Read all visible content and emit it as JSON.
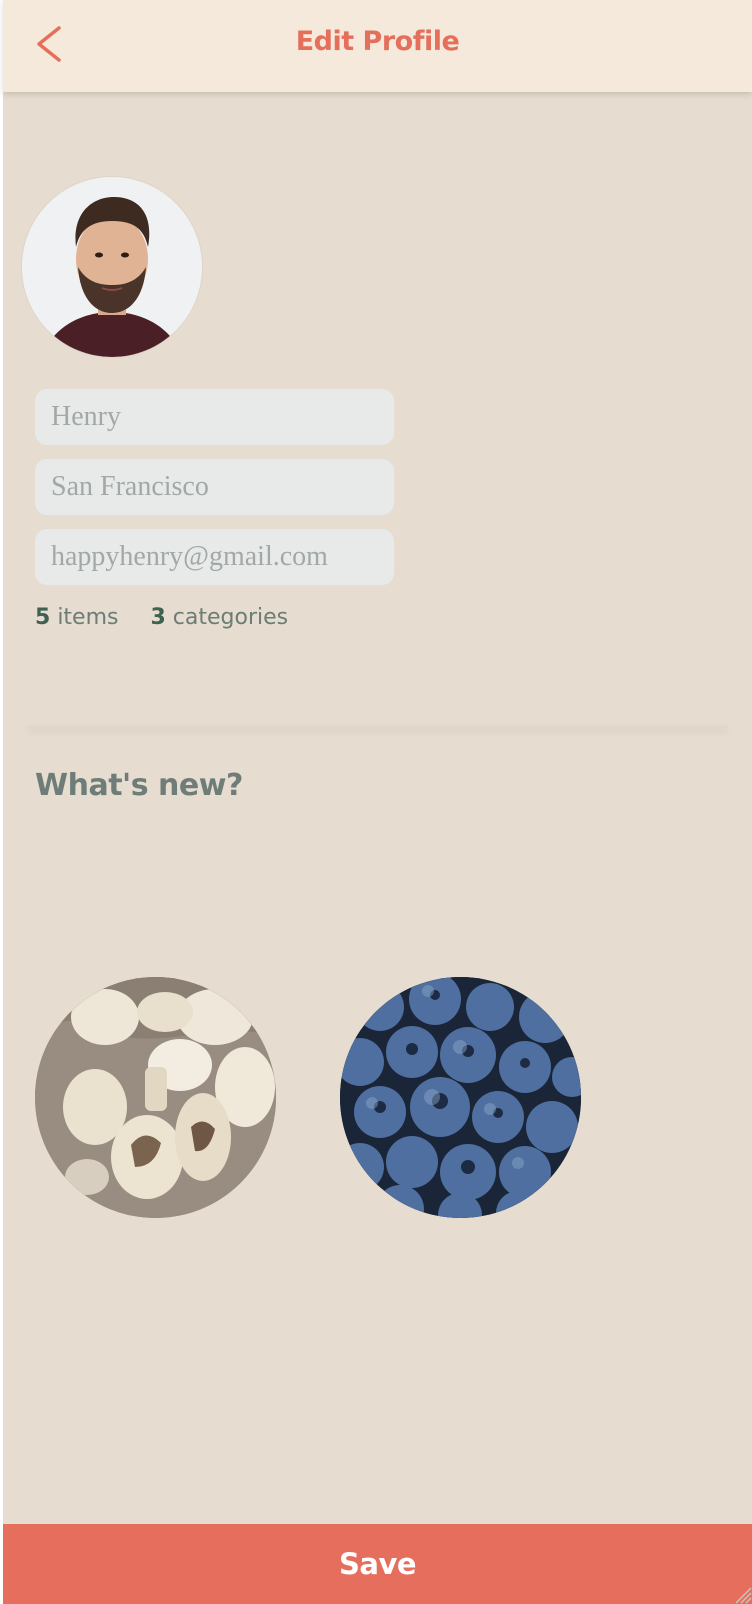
{
  "header": {
    "title": "Edit Profile",
    "back_icon": "chevron-left-icon"
  },
  "profile": {
    "avatar_icon": "user-avatar",
    "name_value": "Henry",
    "city_value": "San Francisco",
    "email_value": "happyhenry@gmail.com",
    "items_count": "5",
    "items_label": "items",
    "categories_count": "3",
    "categories_label": "categories"
  },
  "whats_new": {
    "title": "What's new?",
    "images": [
      "mushrooms-photo",
      "blueberries-photo"
    ]
  },
  "footer": {
    "save_label": "Save"
  },
  "colors": {
    "accent": "#e66e5c",
    "header_bg": "#f5e9db",
    "page_bg": "#e6dccf",
    "field_bg": "#e8eaea",
    "stat_number": "#3f6151",
    "muted_text": "#6f7d78"
  }
}
